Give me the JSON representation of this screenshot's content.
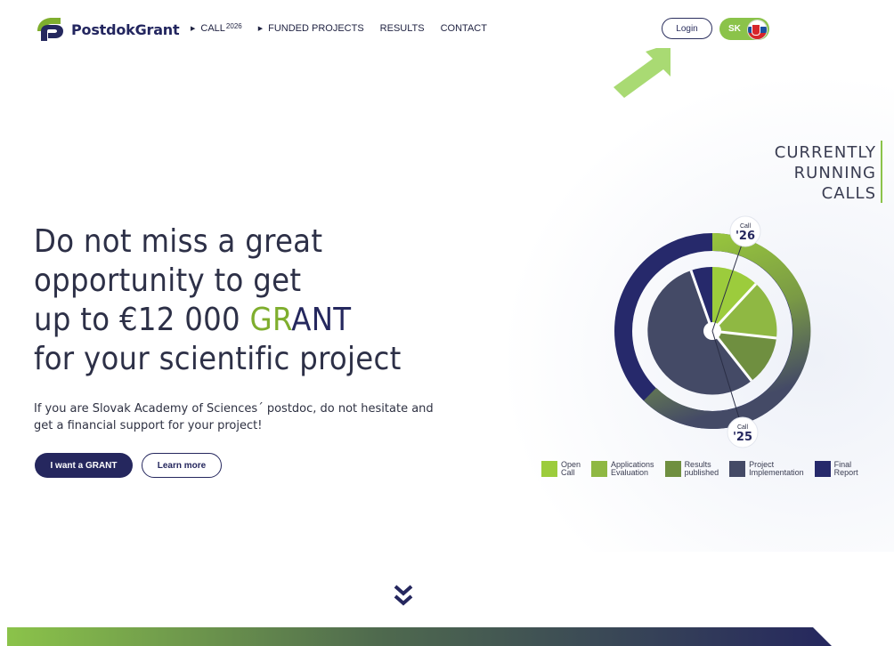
{
  "header": {
    "logo_text": "PostdokGrant",
    "nav": [
      {
        "label": "CALL",
        "sup": "2026",
        "has_arrow": true
      },
      {
        "label": "FUNDED PROJECTS",
        "has_arrow": true
      },
      {
        "label": "RESULTS",
        "has_arrow": false
      },
      {
        "label": "CONTACT",
        "has_arrow": false
      }
    ],
    "login_label": "Login",
    "lang_label": "SK"
  },
  "hero": {
    "line1": "Do not miss a great",
    "line2": "opportunity to get",
    "line3_prefix": "up to €12 000 ",
    "grant_green": "GR",
    "grant_navy": "ANT",
    "line4": "for your scientific project",
    "subtitle": "If you are Slovak Academy of Sciences´ postdoc, do not hesitate and get a financial support for your project!",
    "primary_button": "I want a GRANT",
    "secondary_button": "Learn more"
  },
  "calls": {
    "title_lines": [
      "CURRENTLY",
      "RUNNING",
      "CALLS"
    ],
    "badge_top_small": "Call",
    "badge_top_big": "'26",
    "badge_bottom_small": "Call",
    "badge_bottom_big": "'25"
  },
  "legend": [
    {
      "label": "Open\nCall",
      "color": "#9ccc3c"
    },
    {
      "label": "Applications\nEvaluation",
      "color": "#8fb843"
    },
    {
      "label": "Results\npublished",
      "color": "#6f8f40"
    },
    {
      "label": "Project\nImplementation",
      "color": "#444a66"
    },
    {
      "label": "Final\nReport",
      "color": "#26296b"
    }
  ],
  "colors": {
    "navy": "#25275e",
    "green": "#8bc34a"
  }
}
